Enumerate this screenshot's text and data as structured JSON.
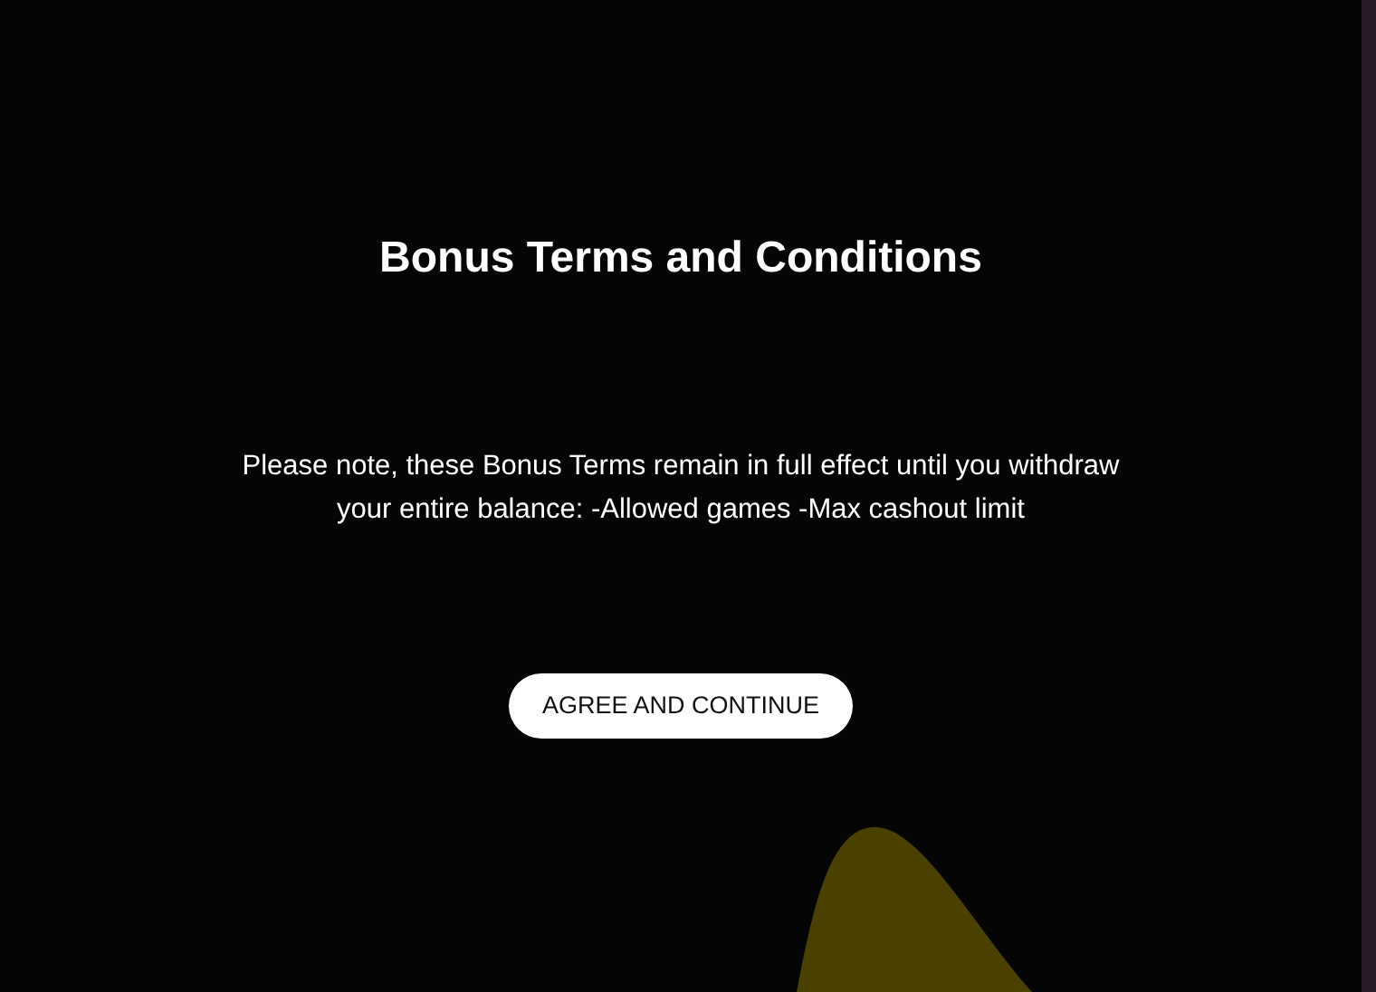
{
  "dialog": {
    "title": "Bonus Terms and Conditions",
    "message": "Please note, these Bonus Terms remain in full effect until you withdraw your entire balance: -Allowed games -Max cashout limit",
    "button": "AGREE AND CONTINUE"
  }
}
